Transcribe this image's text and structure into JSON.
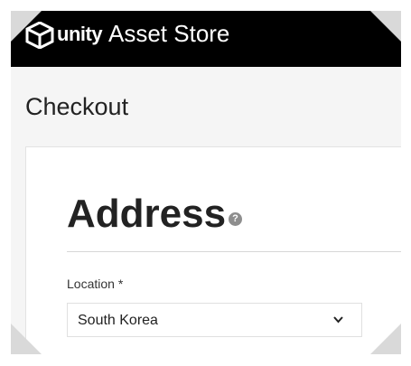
{
  "header": {
    "logo_word": "unity",
    "store_title": "Asset Store",
    "logo_icon": "unity-cube-icon"
  },
  "page": {
    "heading": "Checkout"
  },
  "address": {
    "title": "Address",
    "help_icon": "question-mark-icon",
    "help_glyph": "?",
    "location_label": "Location *",
    "location_value": "South Korea",
    "dropdown_icon": "chevron-down-icon"
  },
  "colors": {
    "header_bg": "#000000",
    "page_bg": "#f5f5f5",
    "card_bg": "#ffffff",
    "help_icon_bg": "#8e8e8e"
  }
}
